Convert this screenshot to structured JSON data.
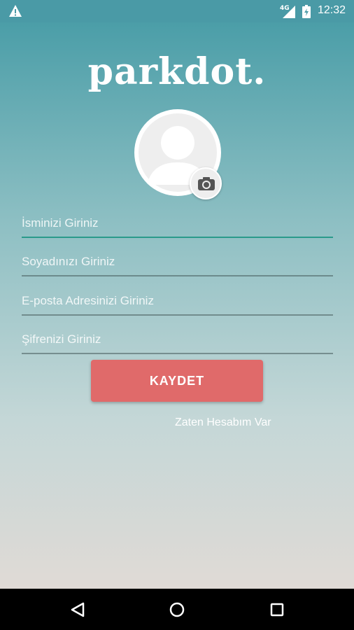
{
  "status_bar": {
    "network": "4G",
    "time": "12:32"
  },
  "app": {
    "logo": "parkdot."
  },
  "form": {
    "first_name_placeholder": "İsminizi Giriniz",
    "last_name_placeholder": "Soyadınızı Giriniz",
    "email_placeholder": "E-posta Adresinizi Giriniz",
    "password_placeholder": "Şifrenizi Giriniz",
    "save_label": "KAYDET",
    "login_link": "Zaten Hesabım Var"
  },
  "colors": {
    "accent": "#e06a6a",
    "active_underline": "#2a9a8a"
  },
  "icons": {
    "status": [
      "warning-icon",
      "signal-icon",
      "battery-icon"
    ],
    "avatar": "person-icon",
    "photo": "camera-icon",
    "nav": [
      "back-icon",
      "home-icon",
      "recents-icon"
    ]
  }
}
